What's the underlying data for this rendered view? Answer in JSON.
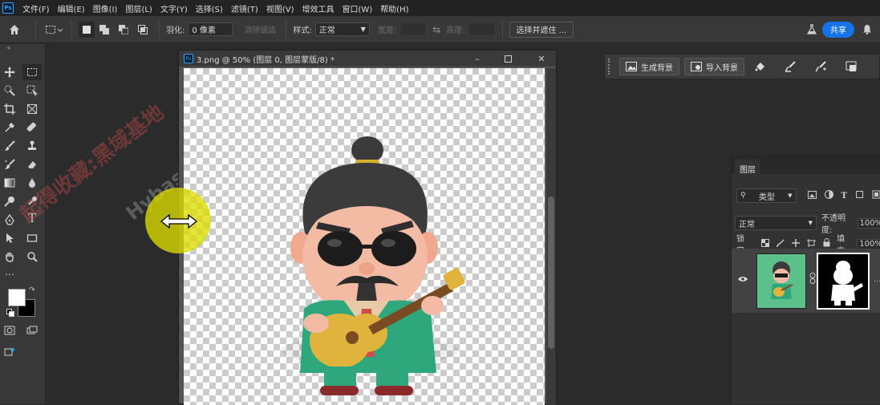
{
  "app": {
    "logo": "Ps"
  },
  "menu": [
    "文件(F)",
    "编辑(E)",
    "图像(I)",
    "图层(L)",
    "文字(Y)",
    "选择(S)",
    "滤镜(T)",
    "视图(V)",
    "增效工具",
    "窗口(W)",
    "帮助(H)"
  ],
  "options": {
    "feather_label": "羽化:",
    "feather_value": "0 像素",
    "antialias_label": "消除锯齿",
    "style_label": "样式:",
    "style_value": "正常",
    "width_label": "宽度:",
    "height_label": "高度:",
    "select_mask_btn": "选择并遮住 ...",
    "share_btn": "共享"
  },
  "document": {
    "title": "3.png @ 50% (图层 0, 图层蒙版/8) *"
  },
  "context_bar": {
    "generate_bg": "生成背景",
    "import_bg": "导入背景"
  },
  "layers_panel": {
    "tab_label": "图层",
    "filter_kind": "类型",
    "blend_mode": "正常",
    "opacity_label": "不透明度:",
    "opacity_value": "100%",
    "lock_label": "锁定:",
    "fill_label": "填充:",
    "fill_value": "100%"
  },
  "watermark": {
    "line1": "起得收藏:黑域基地",
    "line2": "Hybase.com"
  },
  "colors": {
    "accent": "#1473e6",
    "cursor_highlight": "#e6e600",
    "thumb_bg": "#5bc08a"
  }
}
